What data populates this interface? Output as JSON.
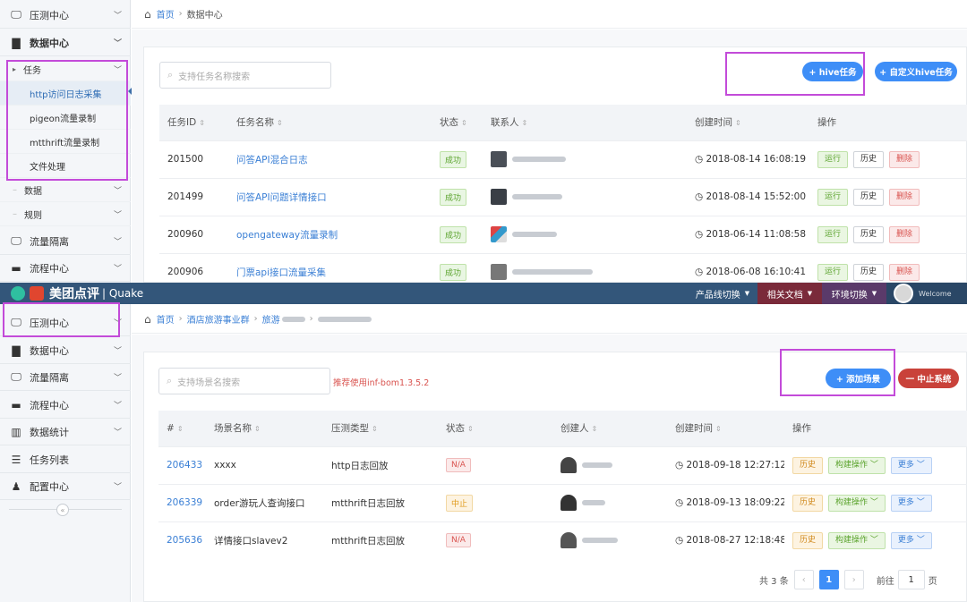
{
  "top": {
    "sidebar": {
      "items": [
        {
          "label": "压测中心",
          "icon": "monitor-icon"
        },
        {
          "label": "数据中心",
          "icon": "folder-icon"
        }
      ],
      "task_group": {
        "label": "任务"
      },
      "subitems": [
        "http访问日志采集",
        "pigeon流量录制",
        "mtthrift流量录制",
        "文件处理"
      ],
      "groups": [
        {
          "label": "数据"
        },
        {
          "label": "规则"
        }
      ],
      "items_bottom": [
        {
          "label": "流量隔离",
          "icon": "monitor-icon"
        },
        {
          "label": "流程中心",
          "icon": "workflow-icon"
        }
      ]
    },
    "breadcrumb": {
      "home": "首页",
      "current": "数据中心"
    },
    "search_placeholder": "支持任务名称搜索",
    "buttons": {
      "hive": "+ hive任务",
      "custom_hive": "+ 自定义hive任务"
    },
    "columns": [
      "任务ID",
      "任务名称",
      "状态",
      "联系人",
      "创建时间",
      "操作"
    ],
    "rows": [
      {
        "id": "201500",
        "name": "问答API混合日志",
        "status": "成功",
        "time": "2018-08-14 16:08:19"
      },
      {
        "id": "201499",
        "name": "问答API问题详情接口",
        "status": "成功",
        "time": "2018-08-14 15:52:00"
      },
      {
        "id": "200960",
        "name": "opengateway流量录制",
        "status": "成功",
        "time": "2018-06-14 11:08:58"
      },
      {
        "id": "200906",
        "name": "门票api接口流量采集",
        "status": "成功",
        "time": "2018-06-08 16:10:41"
      }
    ],
    "ops": {
      "run": "运行",
      "history": "历史",
      "delete": "删除"
    }
  },
  "header": {
    "brand": "美团点评",
    "product": "| Quake",
    "nav": [
      "产品线切换",
      "相关文档",
      "环境切换"
    ],
    "welcome": "Welcome"
  },
  "bottom": {
    "sidebar": {
      "items": [
        {
          "label": "压测中心",
          "icon": "monitor-icon",
          "chev": true
        },
        {
          "label": "数据中心",
          "icon": "folder-icon",
          "chev": true
        },
        {
          "label": "流量隔离",
          "icon": "monitor-icon",
          "chev": true
        },
        {
          "label": "流程中心",
          "icon": "workflow-icon",
          "chev": true
        },
        {
          "label": "数据统计",
          "icon": "bar-chart-icon",
          "chev": true
        },
        {
          "label": "任务列表",
          "icon": "list-icon",
          "chev": false
        },
        {
          "label": "配置中心",
          "icon": "user-config-icon",
          "chev": true
        }
      ],
      "collapse": "«"
    },
    "breadcrumb": {
      "home": "首页",
      "level2": "酒店旅游事业群",
      "level3": "旅游"
    },
    "search_placeholder": "支持场景名搜索",
    "hint": "推荐使用inf-bom1.3.5.2",
    "buttons": {
      "add": "+ 添加场景",
      "stop": "一 中止系统"
    },
    "columns": [
      "#",
      "场景名称",
      "压测类型",
      "状态",
      "创建人",
      "创建时间",
      "操作"
    ],
    "rows": [
      {
        "id": "206433",
        "name": "xxxx",
        "type": "http日志回放",
        "status": "N/A",
        "time": "2018-09-18 12:27:12"
      },
      {
        "id": "206339",
        "name": "order游玩人查询接口",
        "type": "mtthrift日志回放",
        "status": "中止",
        "time": "2018-09-13 18:09:22"
      },
      {
        "id": "205636",
        "name": "详情接口slavev2",
        "type": "mtthrift日志回放",
        "status": "N/A",
        "time": "2018-08-27 12:18:48"
      }
    ],
    "ops": {
      "history": "历史",
      "build": "构建操作",
      "more": "更多"
    },
    "pager": {
      "total": "共 3 条",
      "current": "1",
      "goto": "前往",
      "page_value": "1",
      "page_suffix": "页"
    }
  }
}
